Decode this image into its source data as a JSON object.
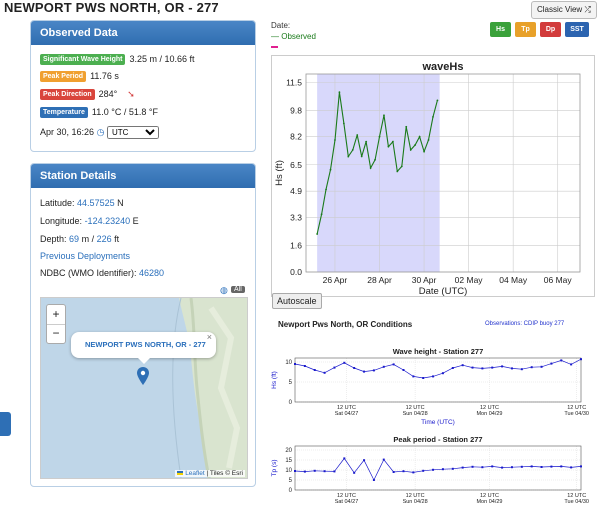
{
  "page_title": "NEWPORT PWS NORTH, OR - 277",
  "top_controls": {
    "classic_view": "Classic View",
    "buttons": [
      {
        "label": "Hs",
        "color": "#3aa13a"
      },
      {
        "label": "Tp",
        "color": "#e8a12a"
      },
      {
        "label": "Dp",
        "color": "#d23b3b"
      },
      {
        "label": "SST",
        "color": "#2c64b0"
      }
    ]
  },
  "legend": {
    "date_label": "Date:",
    "series_label": "— Observed"
  },
  "observed": {
    "header": "Observed Data",
    "rows": [
      {
        "badge": "Significant Wave Height",
        "badge_color": "#4caf50",
        "value": "3.25 m / 10.66 ft"
      },
      {
        "badge": "Peak Period",
        "badge_color": "#f0a030",
        "value": "11.76 s"
      },
      {
        "badge": "Peak Direction",
        "badge_color": "#d9453c",
        "value": "284°"
      },
      {
        "badge": "Temperature",
        "badge_color": "#2e6fb5",
        "value": "11.0 °C / 51.8 °F"
      }
    ],
    "direction_arrow": "➘",
    "datetime": "Apr 30, 16:26",
    "tz_value": "UTC"
  },
  "station": {
    "header": "Station Details",
    "latitude_label": "Latitude:",
    "latitude": "44.57525",
    "latitude_unit": "N",
    "longitude_label": "Longitude:",
    "longitude": "-124.23240",
    "longitude_unit": "E",
    "depth_label": "Depth:",
    "depth_m": "69",
    "depth_m_unit": "m /",
    "depth_ft": "226",
    "depth_ft_unit": "ft",
    "prev_deploy": "Previous Deployments",
    "ndbc_label": "NDBC (WMO Identifier):",
    "ndbc": "46280"
  },
  "map": {
    "popup": "NEWPORT PWS NORTH, OR - 277",
    "zoom_in": "+",
    "zoom_out": "−",
    "close": "×",
    "layer_badge": "All",
    "attribution_leaflet": "Leaflet",
    "attribution_rest": "| Tiles © Esri"
  },
  "autoscale": "Autoscale",
  "chart_data": [
    {
      "type": "line",
      "title": "waveHs",
      "xlabel": "Date (UTC)",
      "ylabel": "Hs (ft)",
      "ylim": [
        0,
        12.0
      ],
      "yticks": [
        "0.0",
        "1.6",
        "3.3",
        "4.9",
        "6.5",
        "8.2",
        "9.8",
        "11.5"
      ],
      "ytick_values": [
        0,
        1.6,
        3.3,
        4.9,
        6.5,
        8.2,
        9.8,
        11.5
      ],
      "xticks": [
        "26 Apr",
        "28 Apr",
        "30 Apr",
        "02 May",
        "04 May",
        "06 May"
      ],
      "xtick_days": [
        26,
        28,
        30,
        32,
        34,
        36
      ],
      "xlim_days": [
        24.7,
        37.0
      ],
      "shaded_days": [
        25.2,
        30.7
      ],
      "grid": true,
      "series": [
        {
          "name": "Observed",
          "color": "#1a7a1a",
          "x": [
            25.2,
            25.4,
            25.6,
            25.8,
            26.0,
            26.2,
            26.4,
            26.6,
            26.8,
            27.0,
            27.2,
            27.4,
            27.6,
            27.8,
            28.0,
            28.2,
            28.4,
            28.6,
            28.8,
            29.0,
            29.2,
            29.4,
            29.6,
            29.8,
            30.0,
            30.2,
            30.4,
            30.6
          ],
          "y": [
            2.3,
            3.5,
            5.0,
            6.2,
            8.0,
            10.9,
            9.0,
            7.0,
            7.4,
            8.3,
            7.0,
            7.9,
            6.3,
            6.8,
            8.2,
            9.5,
            7.6,
            7.9,
            6.1,
            6.4,
            8.8,
            7.4,
            7.7,
            8.2,
            7.3,
            8.0,
            9.4,
            10.4
          ]
        }
      ]
    },
    {
      "type": "line",
      "title": "Wave height - Station 277",
      "header": "Newport Pws North, OR Conditions",
      "observations_note": "Observations: CDIP buoy 277",
      "xlabel": "Time (UTC)",
      "ylabel": "Hs (ft)",
      "ylim": [
        0,
        11
      ],
      "yticks": [
        "0",
        "5",
        "10"
      ],
      "xticks": [
        {
          "line1": "12 UTC",
          "line2": "Sat 04/27"
        },
        {
          "line1": "12 UTC",
          "line2": "Sun 04/28"
        },
        {
          "line1": "12 UTC",
          "line2": "Mon 04/29"
        },
        {
          "line1": "12 UTC",
          "line2": "Tue 04/30"
        }
      ],
      "x": [
        0,
        1,
        2,
        3,
        4,
        5,
        6,
        7,
        8,
        9,
        10,
        11,
        12,
        13,
        14,
        15,
        16,
        17,
        18,
        19,
        20,
        21,
        22,
        23,
        24,
        25,
        26,
        27,
        28,
        29
      ],
      "y": [
        9.5,
        9.0,
        8.0,
        7.3,
        8.6,
        9.8,
        8.5,
        7.6,
        7.9,
        8.8,
        9.4,
        8.0,
        6.4,
        6.0,
        6.4,
        7.2,
        8.5,
        9.2,
        8.6,
        8.4,
        8.6,
        8.9,
        8.4,
        8.2,
        8.7,
        8.8,
        9.6,
        10.4,
        9.4,
        10.7
      ]
    },
    {
      "type": "line",
      "title": "Peak period - Station 277",
      "xlabel": "Time (UTC)",
      "ylabel": "Tp (s)",
      "ylim": [
        0,
        22
      ],
      "yticks": [
        "0",
        "5",
        "10",
        "15",
        "20"
      ],
      "xticks": [
        {
          "line1": "12 UTC",
          "line2": "Sat 04/27"
        },
        {
          "line1": "12 UTC",
          "line2": "Sun 04/28"
        },
        {
          "line1": "12 UTC",
          "line2": "Mon 04/29"
        },
        {
          "line1": "12 UTC",
          "line2": "Tue 04/30"
        }
      ],
      "x": [
        0,
        1,
        2,
        3,
        4,
        5,
        6,
        7,
        8,
        9,
        10,
        11,
        12,
        13,
        14,
        15,
        16,
        17,
        18,
        19,
        20,
        21,
        22,
        23,
        24,
        25,
        26,
        27,
        28,
        29
      ],
      "y": [
        9.5,
        9.2,
        9.6,
        9.4,
        9.3,
        15.8,
        8.6,
        14.9,
        5.0,
        15.2,
        9.0,
        9.4,
        8.8,
        9.6,
        10.1,
        10.4,
        10.6,
        11.2,
        11.6,
        11.4,
        11.8,
        11.2,
        11.4,
        11.6,
        11.8,
        11.5,
        11.7,
        11.8,
        11.3,
        11.8
      ]
    }
  ]
}
